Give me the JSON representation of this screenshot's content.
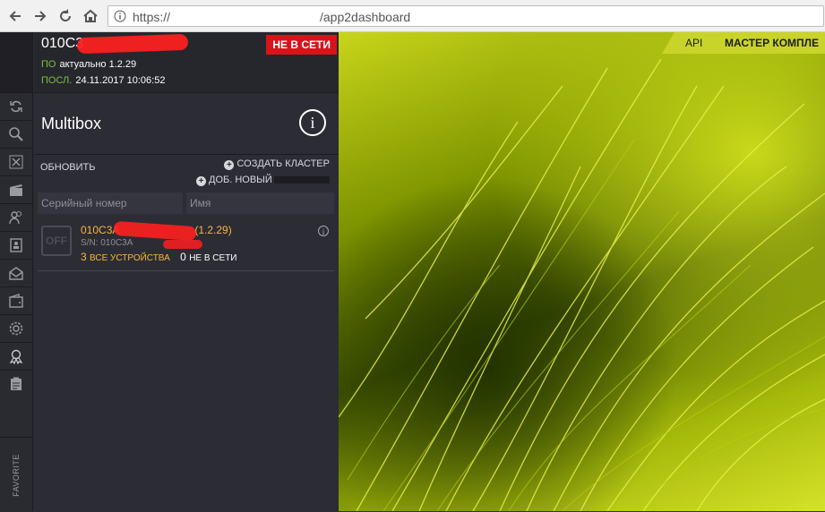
{
  "browser": {
    "url_protocol": "https://",
    "url_path": "/app2dashboard"
  },
  "sidebar": {
    "favorite_label": "FAVORITE",
    "icons": [
      "refresh-icon",
      "search-icon",
      "expand-icon",
      "clapper-icon",
      "users-icon",
      "phonebook-icon",
      "mail-icon",
      "wallet-icon",
      "gear-icon",
      "award-icon",
      "clipboard-icon"
    ]
  },
  "device": {
    "name": "010C3",
    "status": "НЕ В СЕТИ",
    "software_label": "ПО",
    "software_value": "актуально 1.2.29",
    "last_label": "ПОСЛ.",
    "last_value": "24.11.2017 10:06:52"
  },
  "multibox": {
    "title": "Multibox",
    "info_symbol": "i"
  },
  "actions": {
    "refresh": "ОБНОВИТЬ",
    "create_cluster": "СОЗДАТЬ КЛАСТЕР",
    "add_new": "ДОБ. НОВЫЙ"
  },
  "table": {
    "columns": [
      "Серийный номер",
      "Имя"
    ],
    "rows": [
      {
        "badge": "OFF",
        "name": "010C3A",
        "version": "(1.2.29)",
        "sn": "S/N: 010C3A",
        "count_all": "3",
        "all_label": "ВСЕ УСТРОЙСТВА",
        "count_offline": "0",
        "offline_label": "НЕ В СЕТИ"
      }
    ]
  },
  "topnav": {
    "api": "API",
    "master": "МАСТЕР КОМПЛЕ"
  }
}
